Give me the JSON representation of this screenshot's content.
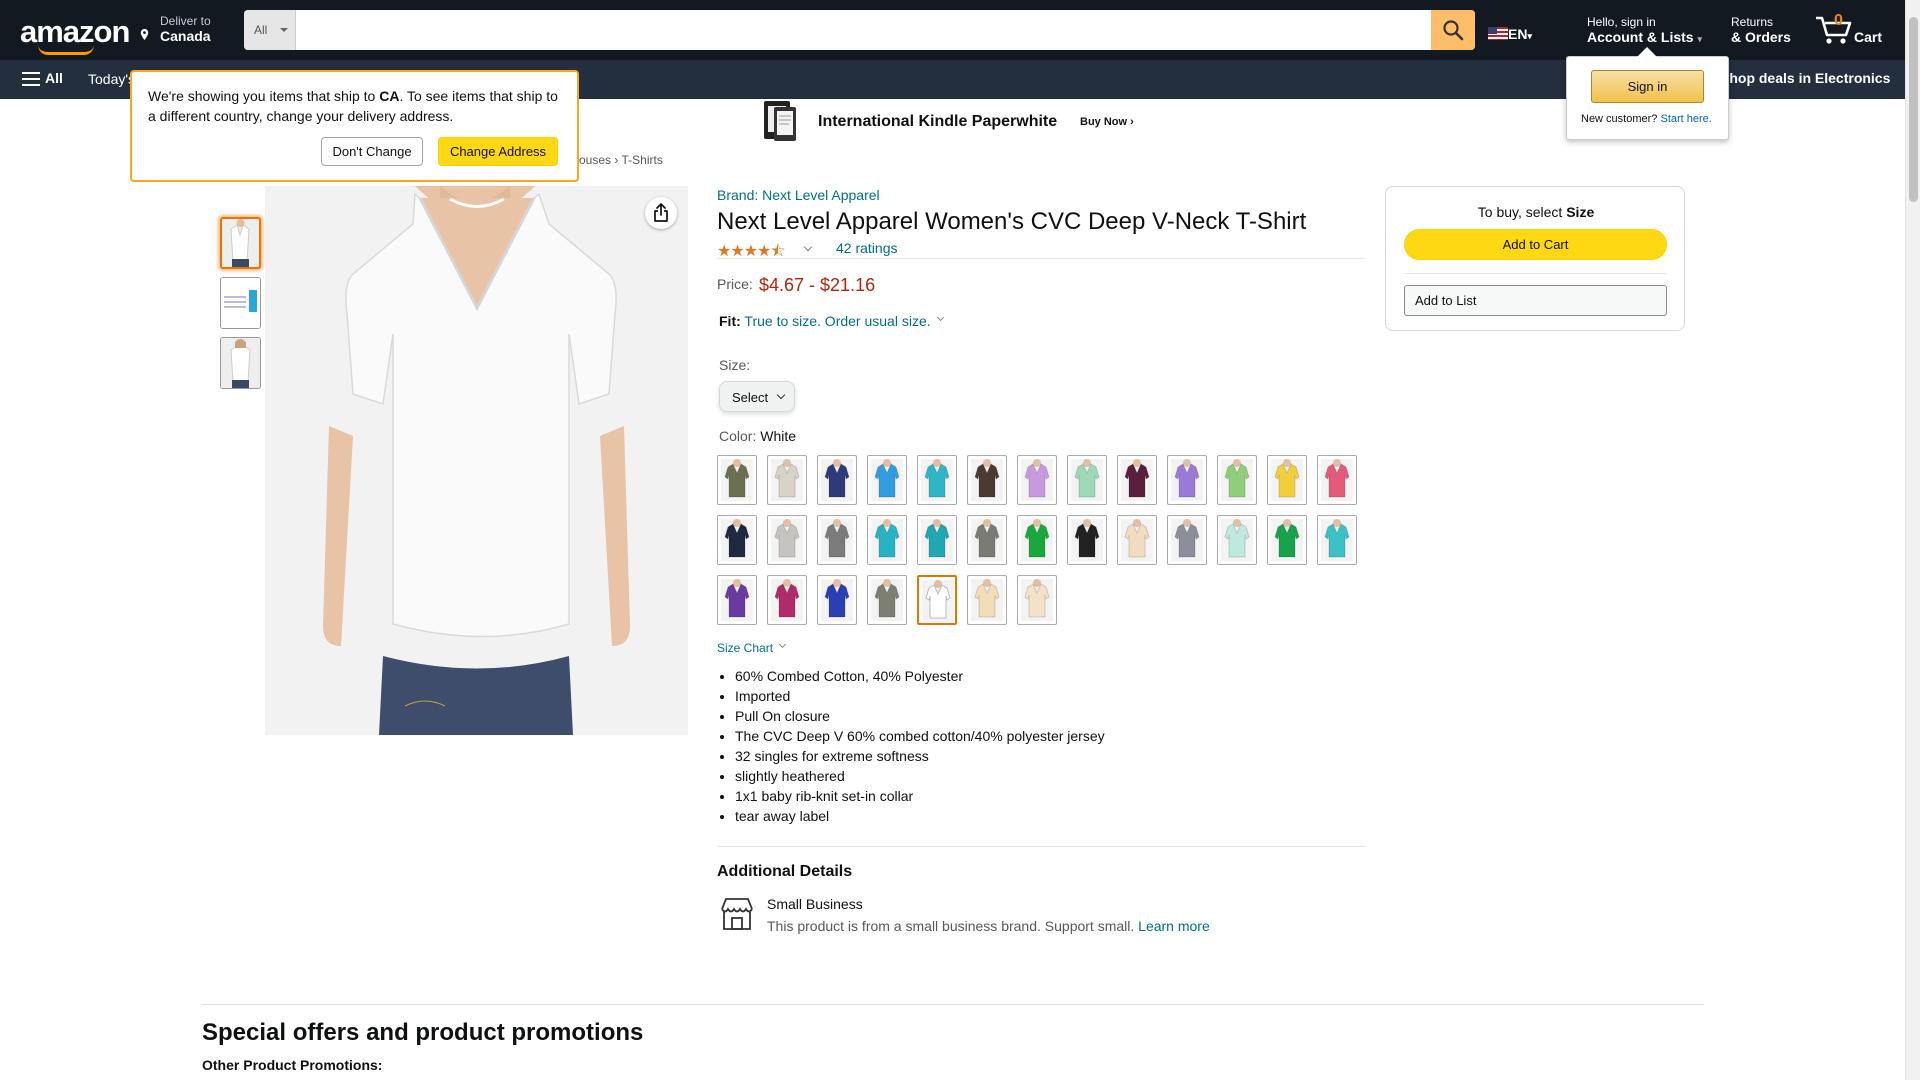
{
  "header": {
    "logo": "amazon",
    "deliver_line1": "Deliver to",
    "deliver_line2": "Canada",
    "search_category": "All",
    "search_placeholder": "",
    "language": "EN",
    "account_line1": "Hello, sign in",
    "account_line2": "Account & Lists",
    "returns_line1": "Returns",
    "returns_line2": "& Orders",
    "cart_count": "0",
    "cart_label": "Cart"
  },
  "subnav": {
    "all_label": "All",
    "items": [
      "Today's Deals"
    ],
    "deals_label": "Shop deals in Electronics"
  },
  "banner": {
    "title": "International Kindle Paperwhite",
    "cta": "Buy Now ›"
  },
  "delivery_popover": {
    "text_part1": "We're showing you items that ship to ",
    "country": "CA",
    "text_part2": ". To see items that ship to a different country, change your delivery address.",
    "dont_change": "Don't Change",
    "change_address": "Change Address"
  },
  "signin_popover": {
    "button": "Sign in",
    "new_customer": "New customer?",
    "start_here": "Start here."
  },
  "breadcrumb": {
    "visible_part": "ouses",
    "separator": "›",
    "last": "T-Shirts"
  },
  "product": {
    "brand": "Brand: Next Level Apparel",
    "title": "Next Level Apparel Women's CVC Deep V-Neck T-Shirt",
    "rating": 4.5,
    "stars_display": "★★★★⯪",
    "ratings_count": "42 ratings",
    "price_label": "Price:",
    "price": "$4.67 - $21.16",
    "fit_label": "Fit:",
    "fit_value": "True to size. Order usual size.",
    "size_label": "Size:",
    "size_select": "Select",
    "color_label": "Color: ",
    "color_value": "White",
    "swatch_colors": [
      "#6b7150",
      "#d9d2c9",
      "#2f3a7a",
      "#2f9de0",
      "#2fb5c8",
      "#4a3a32",
      "#c79ae0",
      "#9fd8b5",
      "#5a1f3a",
      "#9a7ad6",
      "#8fcf7a",
      "#f2cf3a",
      "#e35a7a",
      "#1f2a40",
      "#c7c4bf",
      "#7b7b7b",
      "#27b3c3",
      "#1fa8b3",
      "#7a7b72",
      "#1aa83d",
      "#222222",
      "#f1dcc0",
      "#8b8f99",
      "#bfe8e1",
      "#17a34a",
      "#3cc1c6",
      "#6a3aa0",
      "#b32a6a",
      "#2a3fb3",
      "#7d7f72",
      "#ffffff",
      "#f1ddb8",
      "#f4e2c8"
    ],
    "selected_swatch_index": 30,
    "size_chart": "Size Chart",
    "bullets": [
      "60% Combed Cotton, 40% Polyester",
      "Imported",
      "Pull On closure",
      "The CVC Deep V 60% combed cotton/40% polyester jersey",
      "32 singles for extreme softness",
      "slightly heathered",
      "1x1 baby rib-knit set-in collar",
      "tear away label"
    ],
    "additional_details": "Additional Details",
    "small_business_title": "Small Business",
    "small_business_text": "This product is from a small business brand. Support small. ",
    "learn_more": "Learn more"
  },
  "buybox": {
    "select_text": "To buy, select ",
    "select_bold": "Size",
    "add_to_cart": "Add to Cart",
    "add_to_list": "Add to List"
  },
  "bottom": {
    "offers_title": "Special offers and product promotions",
    "other_promotions": "Other Product Promotions:"
  },
  "colors": {
    "nav_dark": "#131921",
    "nav_secondary": "#232f3e",
    "accent_orange": "#ff9900",
    "button_yellow": "#ffd814",
    "link": "#007185",
    "price_red": "#b12704"
  }
}
